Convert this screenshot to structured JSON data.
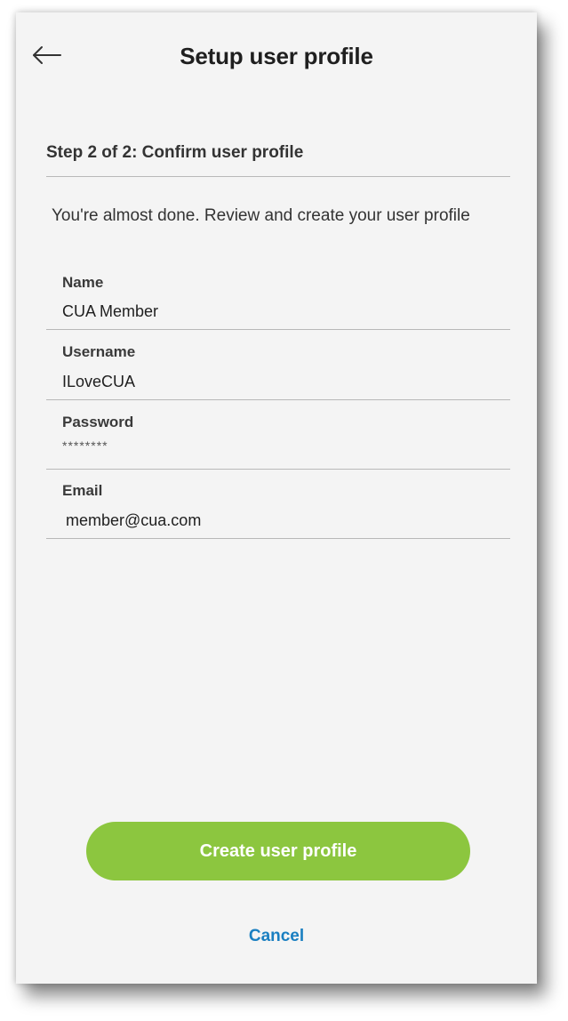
{
  "header": {
    "title": "Setup user profile",
    "back_icon": "arrow-left-icon"
  },
  "step": {
    "title": "Step 2 of 2: Confirm user profile"
  },
  "intro": "You're almost done. Review and create your user profile",
  "fields": [
    {
      "label": "Name",
      "value": "CUA Member"
    },
    {
      "label": "Username",
      "value": "ILoveCUA"
    },
    {
      "label": "Password",
      "value": "********"
    },
    {
      "label": "Email",
      "value": "member@cua.com"
    }
  ],
  "actions": {
    "create_label": "Create user profile",
    "cancel_label": "Cancel"
  },
  "colors": {
    "primary_button": "#8cc63f",
    "link": "#1a7fc1",
    "background": "#f4f4f4"
  }
}
